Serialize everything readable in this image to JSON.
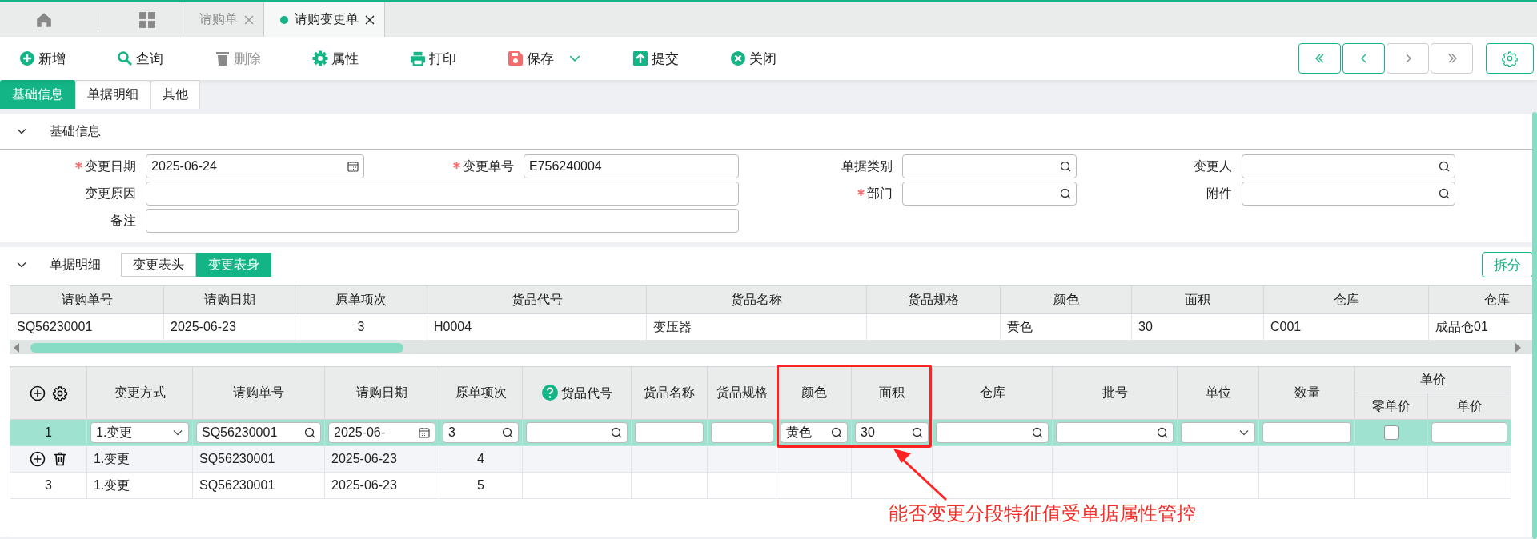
{
  "top_tabs": [
    {
      "label": "请购单",
      "selected": false
    },
    {
      "label": "请购变更单",
      "selected": true
    }
  ],
  "toolbar": [
    {
      "label": "新增",
      "kind": "add",
      "disabled": false,
      "has_menu": false
    },
    {
      "label": "查询",
      "kind": "search",
      "disabled": false,
      "has_menu": false
    },
    {
      "label": "删除",
      "kind": "delete",
      "disabled": true,
      "has_menu": false
    },
    {
      "label": "属性",
      "kind": "settings",
      "disabled": false,
      "has_menu": false
    },
    {
      "label": "打印",
      "kind": "print",
      "disabled": false,
      "has_menu": false
    },
    {
      "label": "保存",
      "kind": "save",
      "disabled": false,
      "has_menu": true
    },
    {
      "label": "提交",
      "kind": "submit",
      "disabled": false,
      "has_menu": false
    },
    {
      "label": "关闭",
      "kind": "close",
      "disabled": false,
      "has_menu": false
    }
  ],
  "nav_buttons": [
    {
      "kind": "first",
      "disabled": false
    },
    {
      "kind": "prev",
      "disabled": false
    },
    {
      "kind": "next",
      "disabled": true
    },
    {
      "kind": "last",
      "disabled": true
    }
  ],
  "page_tabs": [
    {
      "label": "基础信息",
      "selected": true
    },
    {
      "label": "单据明细",
      "selected": false
    },
    {
      "label": "其他",
      "selected": false
    }
  ],
  "basic_info": {
    "title": "基础信息",
    "fields": [
      {
        "label": "变更日期",
        "required": true,
        "kind": "date",
        "value": "2025-06-24"
      },
      {
        "label": "变更单号",
        "required": true,
        "kind": "text",
        "value": "E756240004"
      },
      {
        "label": "单据类别",
        "required": false,
        "kind": "lookup"
      },
      {
        "label": "变更人",
        "required": false,
        "kind": "lookup"
      },
      {
        "label": "变更原因",
        "required": false,
        "kind": "wide"
      },
      {
        "label": "部门",
        "required": true,
        "kind": "lookup"
      },
      {
        "label": "附件",
        "required": false,
        "kind": "lookup"
      },
      {
        "label": "备注",
        "required": false,
        "kind": "wide"
      }
    ]
  },
  "detail": {
    "title": "单据明细",
    "views": [
      {
        "label": "变更表头",
        "selected": false
      },
      {
        "label": "变更表身",
        "selected": true
      }
    ],
    "split_button": "拆分",
    "upper_grid": {
      "columns": [
        "请购单号",
        "请购日期",
        "原单项次",
        "货品代号",
        "货品名称",
        "货品规格",
        "颜色",
        "面积",
        "仓库",
        "仓库"
      ],
      "rows": [
        [
          "SQ56230001",
          "2025-06-23",
          "3",
          "H0004",
          "变压器",
          null,
          "黄色",
          "30",
          "C001",
          "成品仓01"
        ]
      ]
    },
    "lower_grid": {
      "columns": [
        {
          "label": "变更方式",
          "help": false
        },
        {
          "label": "请购单号",
          "help": false
        },
        {
          "label": "请购日期",
          "help": false
        },
        {
          "label": "原单项次",
          "help": false
        },
        {
          "label": "货品代号",
          "help": true
        },
        {
          "label": "货品名称",
          "help": false
        },
        {
          "label": "货品规格",
          "help": false
        },
        {
          "label": "颜色",
          "help": false
        },
        {
          "label": "面积",
          "help": false
        },
        {
          "label": "仓库",
          "help": false
        },
        {
          "label": "批号",
          "help": false
        },
        {
          "label": "单位",
          "help": false
        },
        {
          "label": "数量",
          "help": false
        },
        {
          "group": "单价",
          "children": [
            {
              "label": "零单价"
            },
            {
              "label": "单价"
            }
          ]
        }
      ],
      "rows": [
        {
          "kind": "edit",
          "index": "1",
          "selected": true,
          "hovered": false,
          "editors": [
            {
              "kind": "select",
              "value": "1.变更"
            },
            {
              "kind": "lookup",
              "value": "SQ56230001"
            },
            {
              "kind": "date",
              "value": "2025-06-"
            },
            {
              "kind": "lookup",
              "value": "3"
            },
            {
              "kind": "lookup"
            },
            {
              "kind": "text"
            },
            {
              "kind": "text"
            },
            {
              "kind": "lookup",
              "value": "黄色"
            },
            {
              "kind": "lookup",
              "value": "30"
            },
            {
              "kind": "lookup"
            },
            {
              "kind": "lookup"
            },
            {
              "kind": "select"
            },
            {
              "kind": "text"
            },
            {
              "kind": "checkbox",
              "checked": false
            },
            {
              "kind": "text"
            }
          ]
        },
        {
          "kind": "view",
          "selected": false,
          "hovered": true,
          "cells": [
            "1.变更",
            "SQ56230001",
            "2025-06-23",
            "4"
          ]
        },
        {
          "kind": "view",
          "index": "3",
          "selected": false,
          "hovered": false,
          "cells": [
            "1.变更",
            "SQ56230001",
            "2025-06-23",
            "5"
          ]
        }
      ]
    }
  },
  "annotation": {
    "text": "能否变更分段特征值受单据属性管控"
  }
}
